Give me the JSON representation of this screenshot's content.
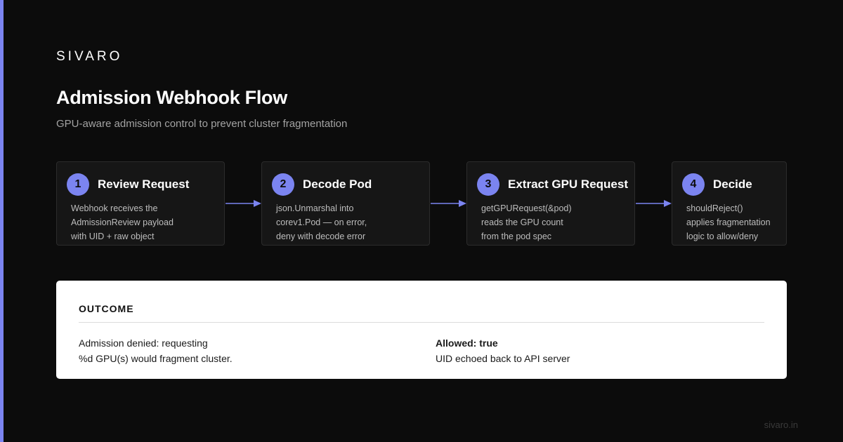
{
  "colors": {
    "background": "#0c0c0c",
    "accent": "#7b84f0",
    "card": "#161616",
    "card_border": "#2c2c2c",
    "outcome_bg": "#ffffff"
  },
  "brand": "SIVARO",
  "title": "Admission Webhook Flow",
  "subtitle": "GPU-aware admission control to prevent cluster fragmentation",
  "steps": [
    {
      "number": "1",
      "title": "Review Request",
      "lines": [
        "Webhook receives the",
        "AdmissionReview payload",
        "with UID + raw object"
      ]
    },
    {
      "number": "2",
      "title": "Decode Pod",
      "lines": [
        "json.Unmarshal into",
        "corev1.Pod — on error,",
        "deny with decode error"
      ]
    },
    {
      "number": "3",
      "title": "Extract GPU Request",
      "lines": [
        "getGPURequest(&pod)",
        "reads the GPU count",
        "from the pod spec"
      ]
    },
    {
      "number": "4",
      "title": "Decide",
      "lines": [
        "shouldReject()",
        "applies fragmentation",
        "logic to allow/deny"
      ]
    }
  ],
  "outcome": {
    "label": "OUTCOME",
    "left_lines": [
      "Admission denied: requesting",
      "%d GPU(s) would fragment cluster."
    ],
    "right_strong": "Allowed: true",
    "right_line": "UID echoed back to API server"
  },
  "footer": "sivaro.in"
}
